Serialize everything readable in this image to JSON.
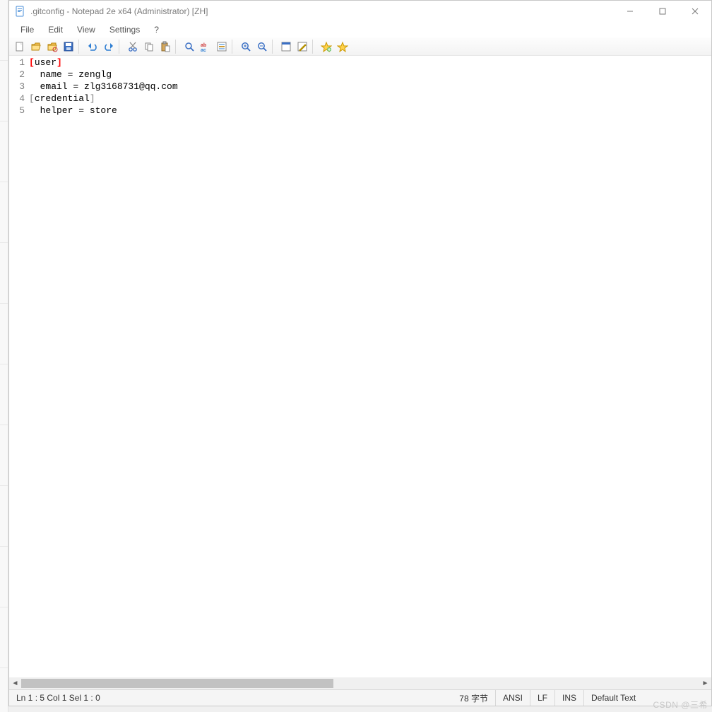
{
  "window": {
    "title": ".gitconfig - Notepad 2e x64 (Administrator) [ZH]"
  },
  "menus": {
    "file": "File",
    "edit": "Edit",
    "view": "View",
    "settings": "Settings",
    "help": "?"
  },
  "toolbar_icons": [
    "new-file-icon",
    "open-file-icon",
    "browse-icon",
    "save-icon",
    "undo-icon",
    "redo-icon",
    "cut-icon",
    "copy-icon",
    "paste-icon",
    "find-icon",
    "replace-icon",
    "goto-icon",
    "zoom-in-icon",
    "zoom-out-icon",
    "scheme-icon",
    "customize-icon",
    "favorites-add-icon",
    "favorites-manage-icon"
  ],
  "editor": {
    "lines": [
      {
        "n": "1",
        "type": "section",
        "open": "[",
        "name": "user",
        "close": "]",
        "style": "red"
      },
      {
        "n": "2",
        "type": "kv",
        "text": "  name = zenglg"
      },
      {
        "n": "3",
        "type": "kv",
        "text": "  email = zlg3168731@qq.com"
      },
      {
        "n": "4",
        "type": "section",
        "open": "[",
        "name": "credential",
        "close": "]",
        "style": "grey"
      },
      {
        "n": "5",
        "type": "kv",
        "text": "  helper = store"
      }
    ]
  },
  "status": {
    "pos": "Ln 1 : 5   Col 1   Sel 1 : 0",
    "size": "78 字节",
    "encoding": "ANSI",
    "eol": "LF",
    "mode": "INS",
    "lexer": "Default Text"
  },
  "watermark": "CSDN @三希"
}
